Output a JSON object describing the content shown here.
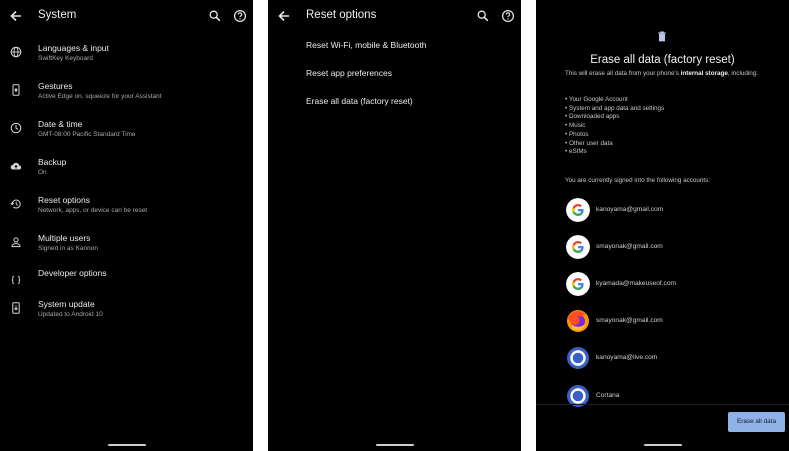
{
  "screen1": {
    "title": "System",
    "items": [
      {
        "label": "Languages & input",
        "sub": "SwiftKey Keyboard",
        "icon": "globe-icon"
      },
      {
        "label": "Gestures",
        "sub": "Active Edge on, squeeze for your Assistant",
        "icon": "phone-gesture-icon"
      },
      {
        "label": "Date & time",
        "sub": "GMT-08:00 Pacific Standard Time",
        "icon": "clock-icon"
      },
      {
        "label": "Backup",
        "sub": "On",
        "icon": "cloud-upload-icon"
      },
      {
        "label": "Reset options",
        "sub": "Network, apps, or device can be reset",
        "icon": "history-icon"
      },
      {
        "label": "Multiple users",
        "sub": "Signed in as Kannon",
        "icon": "person-icon"
      },
      {
        "label": "Developer options",
        "sub": "",
        "icon": "code-braces-icon"
      },
      {
        "label": "System update",
        "sub": "Updated to Android 10",
        "icon": "system-update-icon"
      }
    ]
  },
  "screen2": {
    "title": "Reset options",
    "options": [
      "Reset Wi-Fi, mobile & Bluetooth",
      "Reset app preferences",
      "Erase all data (factory reset)"
    ]
  },
  "screen3": {
    "title": "Erase all data (factory reset)",
    "intro_prefix": "This will erase all data from your phone's ",
    "intro_bold": "internal storage",
    "intro_suffix": ", including:",
    "list": [
      "Your Google Account",
      "System and app data and settings",
      "Downloaded apps",
      "Music",
      "Photos",
      "Other user data",
      "eSIMs"
    ],
    "signed_in_text": "You are currently signed into the following accounts:",
    "accounts": [
      {
        "email": "kanoyama@gmail.com",
        "icon": "google-icon"
      },
      {
        "email": "smayonak@gmail.com",
        "icon": "google-icon"
      },
      {
        "email": "kyamada@makeuseof.com",
        "icon": "google-icon"
      },
      {
        "email": "smayonak@gmail.com",
        "icon": "firefox-icon"
      },
      {
        "email": "kanoyama@live.com",
        "icon": "microsoft-account-icon"
      },
      {
        "email": "Cortana",
        "icon": "cortana-icon"
      }
    ],
    "button_label": "Erase all data"
  },
  "colors": {
    "background": "#000000",
    "text": "#ececec",
    "subtext": "#a8a8a8",
    "button": "#8fb1e6",
    "cortana": "#3b5fc4"
  }
}
